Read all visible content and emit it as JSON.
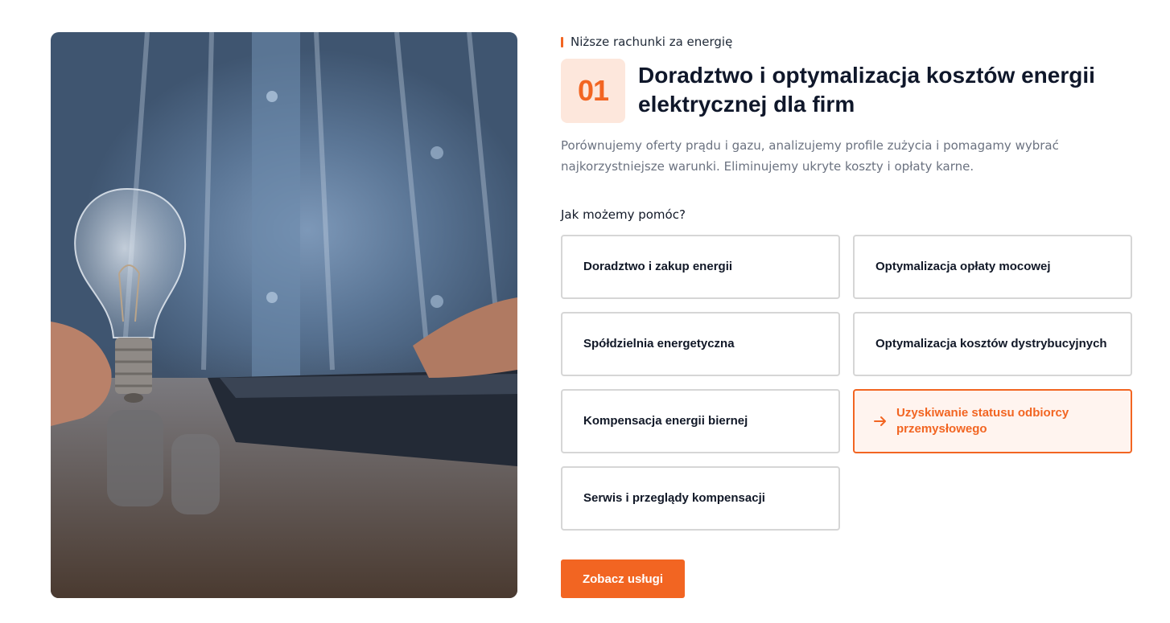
{
  "eyebrow": "Niższe rachunki za energię",
  "number": "01",
  "title": "Doradztwo i optymalizacja kosztów energii elektrycznej dla firm",
  "description": "Porównujemy oferty prądu i gazu, analizujemy profile zużycia i pomagamy wybrać najkorzystniejsze warunki. Eliminujemy ukryte koszty i opłaty karne.",
  "help_label": "Jak możemy pomóc?",
  "services": [
    {
      "label": "Doradztwo i zakup energii",
      "active": false
    },
    {
      "label": "Optymalizacja opłaty mocowej",
      "active": false
    },
    {
      "label": "Spółdzielnia energetyczna",
      "active": false
    },
    {
      "label": "Optymalizacja kosztów dystrybucyjnych",
      "active": false
    },
    {
      "label": "Kompensacja energii biernej",
      "active": false
    },
    {
      "label": "Uzyskiwanie statusu odbiorcy przemysłowego",
      "active": true
    },
    {
      "label": "Serwis i przeglądy kompensacji",
      "active": false
    }
  ],
  "cta_label": "Zobacz usługi",
  "colors": {
    "accent": "#f26522",
    "accent_light": "#fde7dc",
    "border": "#d6d6d6"
  },
  "icons": {
    "active_service": "arrow-right-icon"
  }
}
